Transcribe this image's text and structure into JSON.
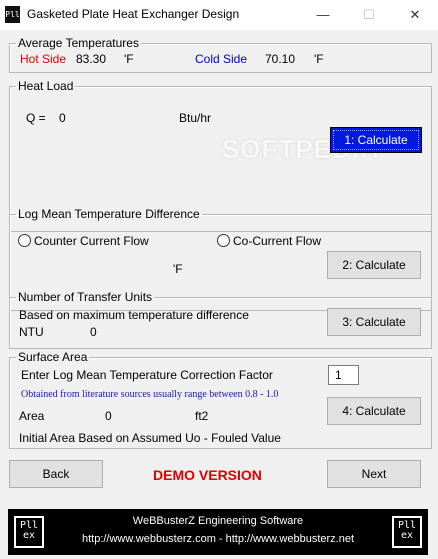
{
  "window": {
    "title": "Gasketed Plate Heat  Exchanger Design",
    "icon_name": "pllex-app-icon",
    "icon_text": "Pll",
    "minimize": "—",
    "maximize": "☐",
    "close": "✕"
  },
  "avg_temps": {
    "legend": "Average Temperatures",
    "hot_label": "Hot Side",
    "hot_value": "83.30",
    "hot_unit": "'F",
    "cold_label": "Cold Side",
    "cold_value": "70.10",
    "cold_unit": "'F",
    "hot_color": "#e00000",
    "cold_color": "#0000cc"
  },
  "heat_load": {
    "legend": "Heat Load",
    "q_label": "Q =",
    "q_value": "0",
    "unit": "Btu/hr",
    "calc_label": "1: Calculate"
  },
  "watermark": "SOFTPEDIA",
  "lmtd": {
    "legend": "Log Mean Temperature Difference",
    "counter_label": "Counter Current Flow",
    "cocurrent_label": "Co-Current Flow",
    "unit": "'F",
    "calc_label": "2: Calculate"
  },
  "ntu": {
    "legend": "Number of Transfer Units",
    "note": "Based on maximum temperature difference",
    "ntu_label": "NTU",
    "ntu_value": "0",
    "calc_label": "3: Calculate"
  },
  "surface_area": {
    "legend": "Surface Area",
    "factor_label": "Enter Log Mean Temperature Correction Factor",
    "factor_value": "1",
    "range_note": "Obtained from literature sources usually range between 0.8 -  1.0",
    "range_color": "#1a1aa6",
    "area_label": "Area",
    "area_value": "0",
    "area_unit": "ft2",
    "calc_label": "4: Calculate",
    "initial_note": "Initial Area Based on Assumed Uo - Fouled Value"
  },
  "nav": {
    "back_label": "Back",
    "demo_label": "DEMO VERSION",
    "next_label": "Next"
  },
  "footer": {
    "company": "WeBBusterZ Engineering Software",
    "urls": "http://www.webbusterz.com - http://www.webbusterz.net",
    "logo_text": "Pll ex"
  }
}
